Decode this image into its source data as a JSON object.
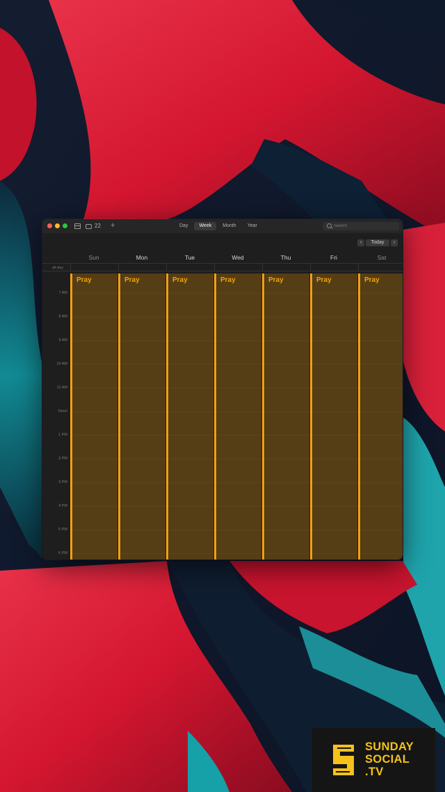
{
  "colors": {
    "accent": "#f2a012",
    "event_fill": "#5a3f17",
    "window_bg": "#1e1e1e",
    "brand_yellow": "#f4c21b"
  },
  "toolbar": {
    "calendar_list_icon": "calendar-list-icon",
    "inbox_icon": "inbox-icon",
    "inbox_count": "22",
    "add_label": "+",
    "view_segments": [
      {
        "label": "Day",
        "active": false
      },
      {
        "label": "Week",
        "active": true
      },
      {
        "label": "Month",
        "active": false
      },
      {
        "label": "Year",
        "active": false
      }
    ],
    "search": {
      "placeholder": "Search",
      "value": ""
    }
  },
  "navigation": {
    "prev_label": "‹",
    "today_label": "Today",
    "next_label": "›"
  },
  "week": {
    "days": [
      "Sun",
      "Mon",
      "Tue",
      "Wed",
      "Thu",
      "Fri",
      "Sat"
    ],
    "all_day_label": "all-day",
    "hours": [
      "7 AM",
      "8 AM",
      "9 AM",
      "10 AM",
      "11 AM",
      "Noon",
      "1 PM",
      "2 PM",
      "3 PM",
      "4 PM",
      "5 PM",
      "6 PM"
    ]
  },
  "events": [
    {
      "day": "Sun",
      "title": "Pray"
    },
    {
      "day": "Mon",
      "title": "Pray"
    },
    {
      "day": "Tue",
      "title": "Pray"
    },
    {
      "day": "Wed",
      "title": "Pray"
    },
    {
      "day": "Thu",
      "title": "Pray"
    },
    {
      "day": "Fri",
      "title": "Pray"
    },
    {
      "day": "Sat",
      "title": "Pray"
    }
  ],
  "brand": {
    "line1": "SUNDAY",
    "line2": "SOCIAL",
    "line3": ".TV"
  }
}
